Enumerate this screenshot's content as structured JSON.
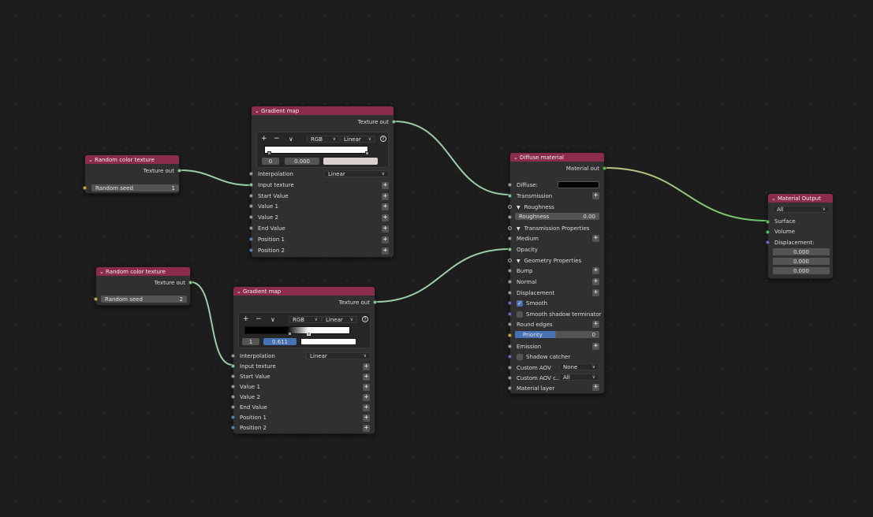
{
  "nodes": {
    "random1": {
      "title": "Random color texture",
      "output": "Texture out",
      "seed_label": "Random seed",
      "seed_value": "1"
    },
    "random2": {
      "title": "Random color texture",
      "output": "Texture out",
      "seed_label": "Random seed",
      "seed_value": "2"
    },
    "grad1": {
      "title": "Gradient map",
      "output": "Texture out",
      "add_label": "+",
      "remove_label": "−",
      "chevron": "∨",
      "color_mode": "RGB",
      "interp_mode": "Linear",
      "help_label": "?",
      "stop_index": "0",
      "stop_pos": "0.000",
      "stop_color": "#dcd0d0",
      "gradient": [
        "#ffffff",
        "#ffffff"
      ],
      "inputs": {
        "interpolation_label": "Interpolation",
        "interpolation_value": "Linear",
        "input_texture": "Input texture",
        "start_value": "Start Value",
        "value1": "Value 1",
        "value2": "Value 2",
        "end_value": "End Value",
        "position1": "Position 1",
        "position2": "Position 2"
      }
    },
    "grad2": {
      "title": "Gradient map",
      "output": "Texture out",
      "add_label": "+",
      "remove_label": "−",
      "chevron": "∨",
      "color_mode": "RGB",
      "interp_mode": "Linear",
      "help_label": "?",
      "stop_index": "1",
      "stop_pos": "0.611",
      "stop_color": "#ffffff",
      "gradient": [
        "#000000",
        "#ffffff"
      ],
      "inputs": {
        "interpolation_label": "Interpolation",
        "interpolation_value": "Linear",
        "input_texture": "Input texture",
        "start_value": "Start Value",
        "value1": "Value 1",
        "value2": "Value 2",
        "end_value": "End Value",
        "position1": "Position 1",
        "position2": "Position 2"
      }
    },
    "diffuse": {
      "title": "Diffuse material",
      "output": "Material out",
      "diffuse_label": "Diffuse:",
      "diffuse_color": "#000000",
      "transmission": "Transmission",
      "roughness_section": "Roughness",
      "roughness_label": "Roughness",
      "roughness_value": "0.00",
      "transmission_props": "Transmission Properties",
      "medium": "Medium",
      "opacity": "Opacity",
      "geometry_props": "Geometry Properties",
      "bump": "Bump",
      "normal": "Normal",
      "displacement": "Displacement",
      "smooth": "Smooth",
      "smooth_shadow": "Smooth shadow terminator",
      "round_edges": "Round edges",
      "priority_label": "Priority",
      "priority_value": "0",
      "emission": "Emission",
      "shadow_catcher": "Shadow catcher",
      "custom_aov": "Custom AOV",
      "custom_aov_value": "None",
      "custom_aov_c": "Custom AOV c...",
      "custom_aov_c_value": "All",
      "material_layer": "Material layer"
    },
    "output": {
      "title": "Material Output",
      "target": "All",
      "surface": "Surface",
      "volume": "Volume",
      "displacement": "Displacement:",
      "vec": [
        "0.000",
        "0.000",
        "0.000"
      ]
    }
  },
  "colors": {
    "header": "#8b2c4a",
    "wire": "#9acda8",
    "wire_material": "#c8c08a",
    "wire_material_end": "#63c763",
    "accent": "#4772b3"
  }
}
